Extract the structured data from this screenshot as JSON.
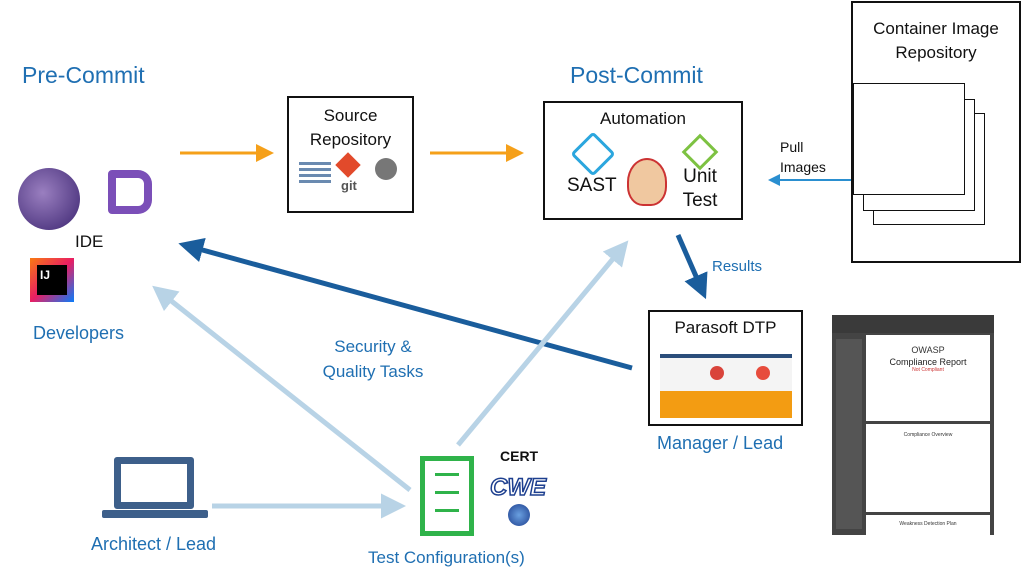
{
  "stages": {
    "pre": "Pre-Commit",
    "post": "Post-Commit"
  },
  "source_repo": {
    "title": "Source Repository",
    "git": "git"
  },
  "automation": {
    "title": "Automation",
    "sast": "SAST",
    "unit_test_1": "Unit",
    "unit_test_2": "Test"
  },
  "container": {
    "title_1": "Container Image",
    "title_2": "Repository"
  },
  "pull": {
    "l1": "Pull",
    "l2": "Images"
  },
  "results": "Results",
  "dtp": {
    "title": "Parasoft DTP",
    "role": "Manager / Lead"
  },
  "ide": {
    "label": "IDE",
    "role": "Developers",
    "ij": "IJ"
  },
  "tasks": {
    "l1": "Security &",
    "l2": "Quality Tasks"
  },
  "architect": "Architect / Lead",
  "testconf": {
    "label": "Test Configuration(s)",
    "cert": "CERT",
    "cwe": "CWE"
  },
  "report": {
    "logo": "OWASP",
    "title": "Compliance Report",
    "status": "Not Compliant",
    "overview": "Compliance Overview",
    "plan": "Weakness Detection Plan"
  },
  "colors": {
    "orange": "#f5a01a",
    "dark_blue": "#1a5d9c",
    "light_blue": "#b8d3e6",
    "text_blue": "#1f6fb2",
    "green": "#2fb34a"
  }
}
